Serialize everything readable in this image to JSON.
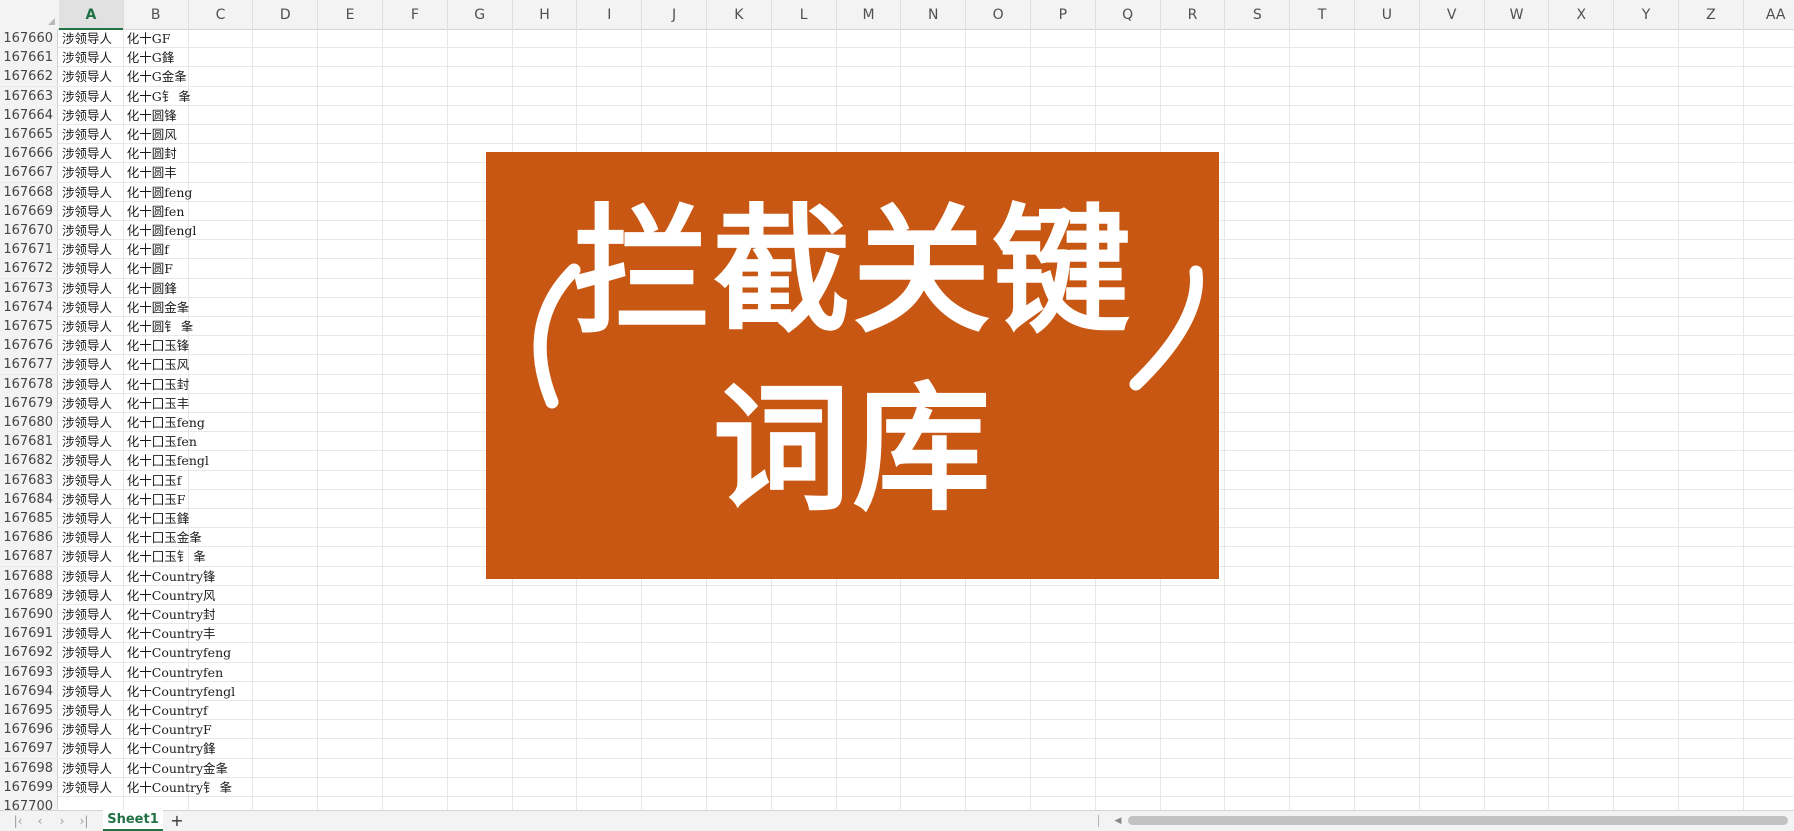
{
  "columns": [
    "A",
    "B",
    "C",
    "D",
    "E",
    "F",
    "G",
    "H",
    "I",
    "J",
    "K",
    "L",
    "M",
    "N",
    "O",
    "P",
    "Q",
    "R",
    "S",
    "T",
    "U",
    "V",
    "W",
    "X",
    "Y",
    "Z",
    "AA"
  ],
  "selected_column": "A",
  "rows": [
    {
      "num": "167660",
      "a": "涉领导人",
      "b": "化十GF"
    },
    {
      "num": "167661",
      "a": "涉领导人",
      "b": "化十G鋒"
    },
    {
      "num": "167662",
      "a": "涉领导人",
      "b": "化十G金夆"
    },
    {
      "num": "167663",
      "a": "涉领导人",
      "b": "化十G钅 夆"
    },
    {
      "num": "167664",
      "a": "涉领导人",
      "b": "化十圆锋"
    },
    {
      "num": "167665",
      "a": "涉领导人",
      "b": "化十圆风"
    },
    {
      "num": "167666",
      "a": "涉领导人",
      "b": "化十圆封"
    },
    {
      "num": "167667",
      "a": "涉领导人",
      "b": "化十圆丰"
    },
    {
      "num": "167668",
      "a": "涉领导人",
      "b": "化十圆feng"
    },
    {
      "num": "167669",
      "a": "涉领导人",
      "b": "化十圆fen"
    },
    {
      "num": "167670",
      "a": "涉领导人",
      "b": "化十圆fengl"
    },
    {
      "num": "167671",
      "a": "涉领导人",
      "b": "化十圆f"
    },
    {
      "num": "167672",
      "a": "涉领导人",
      "b": "化十圆F"
    },
    {
      "num": "167673",
      "a": "涉领导人",
      "b": "化十圆鋒"
    },
    {
      "num": "167674",
      "a": "涉领导人",
      "b": "化十圆金夆"
    },
    {
      "num": "167675",
      "a": "涉领导人",
      "b": "化十圆钅 夆"
    },
    {
      "num": "167676",
      "a": "涉领导人",
      "b": "化十囗玉锋"
    },
    {
      "num": "167677",
      "a": "涉领导人",
      "b": "化十囗玉风"
    },
    {
      "num": "167678",
      "a": "涉领导人",
      "b": "化十囗玉封"
    },
    {
      "num": "167679",
      "a": "涉领导人",
      "b": "化十囗玉丰"
    },
    {
      "num": "167680",
      "a": "涉领导人",
      "b": "化十囗玉feng"
    },
    {
      "num": "167681",
      "a": "涉领导人",
      "b": "化十囗玉fen"
    },
    {
      "num": "167682",
      "a": "涉领导人",
      "b": "化十囗玉fengl"
    },
    {
      "num": "167683",
      "a": "涉领导人",
      "b": "化十囗玉f"
    },
    {
      "num": "167684",
      "a": "涉领导人",
      "b": "化十囗玉F"
    },
    {
      "num": "167685",
      "a": "涉领导人",
      "b": "化十囗玉鋒"
    },
    {
      "num": "167686",
      "a": "涉领导人",
      "b": "化十囗玉金夆"
    },
    {
      "num": "167687",
      "a": "涉领导人",
      "b": "化十囗玉钅 夆"
    },
    {
      "num": "167688",
      "a": "涉领导人",
      "b": "化十Country锋"
    },
    {
      "num": "167689",
      "a": "涉领导人",
      "b": "化十Country风"
    },
    {
      "num": "167690",
      "a": "涉领导人",
      "b": "化十Country封"
    },
    {
      "num": "167691",
      "a": "涉领导人",
      "b": "化十Country丰"
    },
    {
      "num": "167692",
      "a": "涉领导人",
      "b": "化十Countryfeng"
    },
    {
      "num": "167693",
      "a": "涉领导人",
      "b": "化十Countryfen"
    },
    {
      "num": "167694",
      "a": "涉领导人",
      "b": "化十Countryfengl"
    },
    {
      "num": "167695",
      "a": "涉领导人",
      "b": "化十Countryf"
    },
    {
      "num": "167696",
      "a": "涉领导人",
      "b": "化十CountryF"
    },
    {
      "num": "167697",
      "a": "涉领导人",
      "b": "化十Country鋒"
    },
    {
      "num": "167698",
      "a": "涉领导人",
      "b": "化十Country金夆"
    },
    {
      "num": "167699",
      "a": "涉领导人",
      "b": "化十Country钅 夆"
    },
    {
      "num": "167700",
      "a": "",
      "b": ""
    }
  ],
  "banner": {
    "line1": "拦截关键",
    "line2": "词库",
    "color": "#c85713"
  },
  "sheet_tabs": [
    "Sheet1"
  ],
  "add_sheet_label": "+",
  "accent_color": "#217346"
}
